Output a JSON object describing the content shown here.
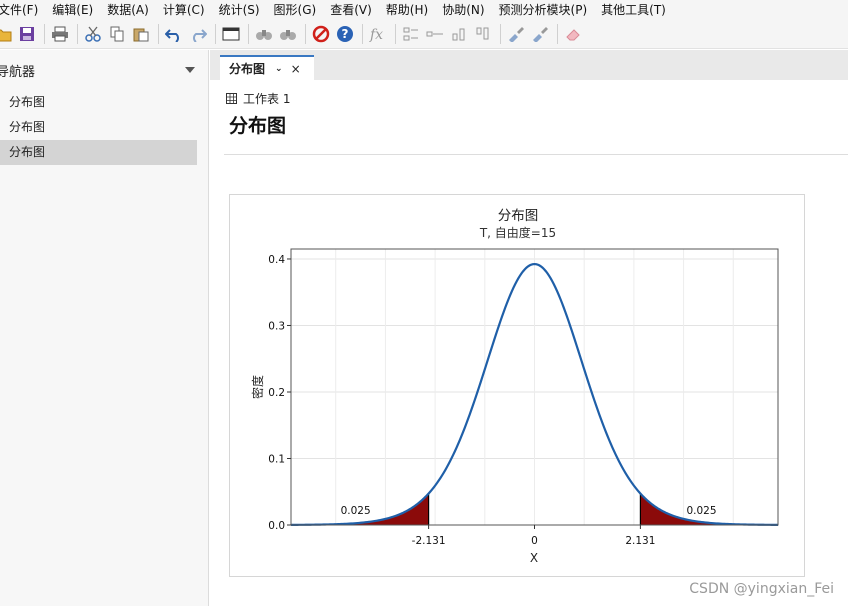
{
  "menu": [
    "文件(F)",
    "编辑(E)",
    "数据(A)",
    "计算(C)",
    "统计(S)",
    "图形(G)",
    "查看(V)",
    "帮助(H)",
    "协助(N)",
    "预测分析模块(P)",
    "其他工具(T)"
  ],
  "toolbar": {
    "icons": [
      "open-icon",
      "save-icon",
      "print-icon",
      "cut-icon",
      "copy-icon",
      "paste-icon",
      "undo-icon",
      "redo-icon",
      "window-icon",
      "find-icon",
      "find-replace-icon",
      "cancel-icon",
      "help-icon",
      "function-icon",
      "align-left-icon",
      "align-center-icon",
      "align-bottom-icon",
      "align-top-icon",
      "brush-icon",
      "brush-edit-icon",
      "eraser-icon"
    ]
  },
  "sidebar": {
    "title": "导航器",
    "items": [
      {
        "label": "分布图",
        "selected": false
      },
      {
        "label": "分布图",
        "selected": false
      },
      {
        "label": "分布图",
        "selected": true
      }
    ]
  },
  "tab": {
    "label": "分布图",
    "close": "×"
  },
  "breadcrumb": "工作表 1",
  "page_title": "分布图",
  "watermark": "CSDN @yingxian_Fei",
  "colors": {
    "curve": "#1f5fa8",
    "tail_fill": "#8b0a0a",
    "accent": "#3a78c2"
  },
  "chart_data": {
    "type": "area",
    "title": "分布图",
    "subtitle": "T, 自由度=15",
    "xlabel": "X",
    "ylabel": "密度",
    "df": 15,
    "xlim": [
      -4.9,
      4.9
    ],
    "ylim": [
      0,
      0.4
    ],
    "yticks": [
      0.0,
      0.1,
      0.2,
      0.3,
      0.4
    ],
    "ytick_labels": [
      "0.0",
      "0.1",
      "0.2",
      "0.3",
      "0.4"
    ],
    "xticks": [
      -2.131,
      0,
      2.131
    ],
    "xtick_labels": [
      "-2.131",
      "0",
      "2.131"
    ],
    "shaded_tails": [
      {
        "from": -4.9,
        "to": -2.131,
        "label": "0.025"
      },
      {
        "from": 2.131,
        "to": 4.9,
        "label": "0.025"
      }
    ],
    "peak_density": 0.392,
    "grid": true
  }
}
